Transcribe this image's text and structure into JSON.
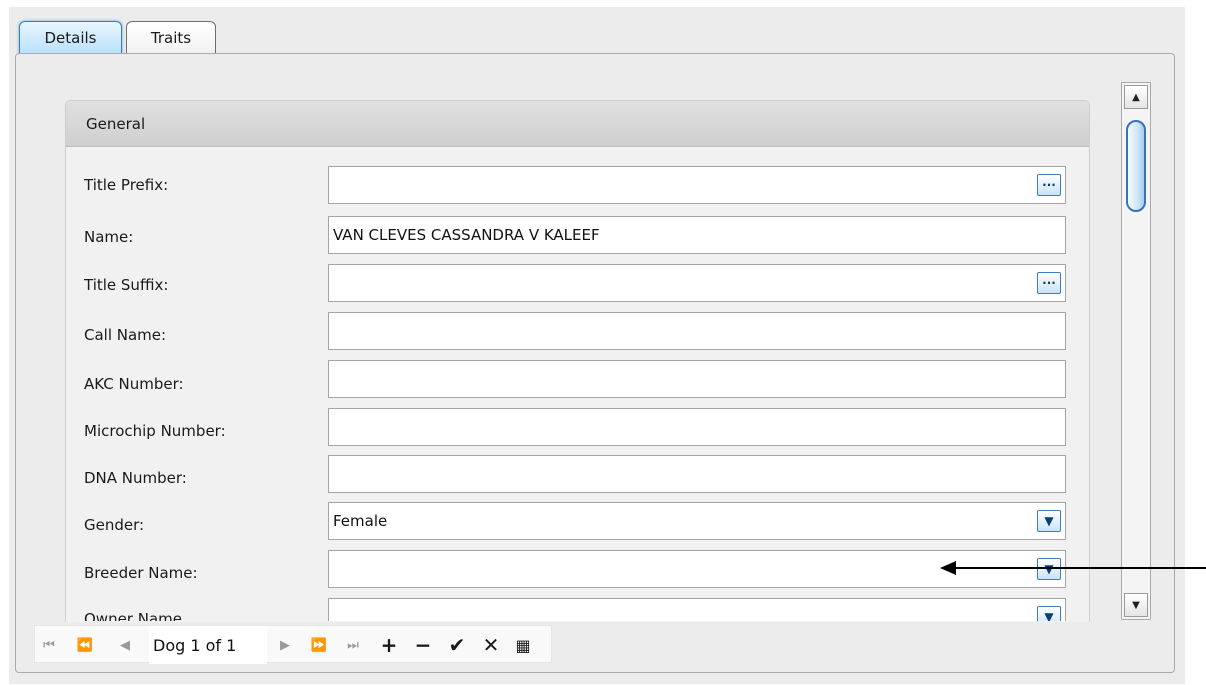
{
  "tabs": [
    {
      "label": "Details",
      "active": true
    },
    {
      "label": "Traits",
      "active": false
    }
  ],
  "group": {
    "title": "General"
  },
  "fields": {
    "title_prefix": {
      "label": "Title Prefix:",
      "value": "",
      "button": "lookup"
    },
    "name": {
      "label": "Name:",
      "value": "VAN CLEVES CASSANDRA V KALEEF"
    },
    "title_suffix": {
      "label": "Title Suffix:",
      "value": "",
      "button": "lookup"
    },
    "call_name": {
      "label": "Call Name:",
      "value": ""
    },
    "akc_number": {
      "label": "AKC Number:",
      "value": ""
    },
    "microchip_number": {
      "label": "Microchip Number:",
      "value": ""
    },
    "dna_number": {
      "label": "DNA Number:",
      "value": ""
    },
    "gender": {
      "label": "Gender:",
      "value": "Female",
      "button": "dropdown"
    },
    "breeder_name": {
      "label": "Breeder Name:",
      "value": "",
      "button": "dropdown"
    },
    "owner_name_partial": {
      "label": "Owner Name",
      "value": "",
      "button": "dropdown"
    }
  },
  "navigator": {
    "position_text": "Dog 1 of 1",
    "buttons": [
      {
        "name": "first-page",
        "glyph": "⏮"
      },
      {
        "name": "previous-page",
        "glyph": "⏪"
      },
      {
        "name": "previous",
        "glyph": "◀"
      },
      {
        "name": "next",
        "glyph": "▶"
      },
      {
        "name": "next-page",
        "glyph": "⏩"
      },
      {
        "name": "last",
        "glyph": "⏭"
      },
      {
        "name": "append",
        "glyph": "+"
      },
      {
        "name": "delete",
        "glyph": "−"
      },
      {
        "name": "post",
        "glyph": "✔"
      },
      {
        "name": "cancel",
        "glyph": "✕"
      },
      {
        "name": "filter",
        "glyph": "▦"
      }
    ]
  },
  "scrollbar": {
    "up_glyph": "▲",
    "down_glyph": "▼"
  },
  "icons": {
    "lookup": "ellipsis-icon",
    "dropdown": "chevron-down-icon"
  },
  "colors": {
    "accent": "#3a7fc0",
    "active_tab": "#b9e0fb",
    "panel_bg": "#ececec"
  }
}
